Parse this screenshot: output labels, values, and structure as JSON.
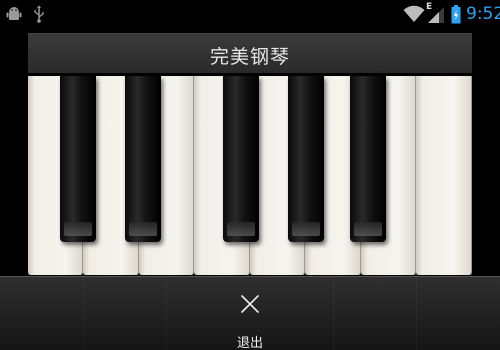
{
  "status_bar": {
    "time": "9:52",
    "network_type": "E",
    "icons": [
      "android-icon",
      "usb-icon",
      "wifi-icon",
      "signal-icon",
      "battery-icon"
    ],
    "clock_color": "#2ea3f2"
  },
  "app": {
    "title": "完美钢琴"
  },
  "piano": {
    "white_key_count": 8,
    "black_key_count": 5
  },
  "bottom_bar": {
    "exit_label": "退出",
    "exit_icon": "close-icon"
  }
}
